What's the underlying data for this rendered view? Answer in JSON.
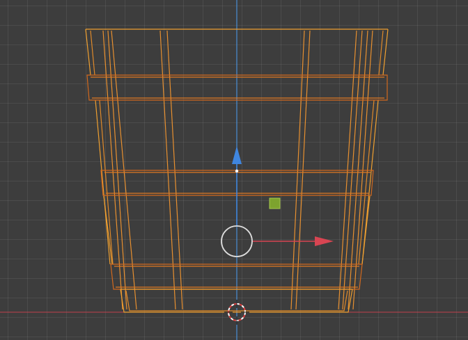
{
  "app": {
    "type": "3d-viewport",
    "view": "front-orthographic",
    "mode": "edit",
    "display": "wireframe"
  },
  "colors": {
    "background": "#3d3d3d",
    "grid_line": "#4a4a4a",
    "x_axis": "#c1404d",
    "z_axis": "#4a8fd6",
    "mesh_light": "#f0a030",
    "mesh_dark": "#d2691e",
    "gizmo_x": "#d84552",
    "gizmo_z": "#3f86e0",
    "transform_ring": "#dddddd",
    "origin_marker": "#7da32e",
    "cursor_red": "#e04040",
    "cursor_white": "#ffffff"
  },
  "icons": {
    "cursor": "3d-cursor-icon",
    "gizmo_x_arrow": "x-axis-arrow-icon",
    "gizmo_z_arrow": "z-axis-arrow-icon",
    "transform_center": "transform-ring-icon",
    "origin": "object-origin-icon"
  },
  "object": {
    "name": "bucket-mesh",
    "selected": true
  }
}
